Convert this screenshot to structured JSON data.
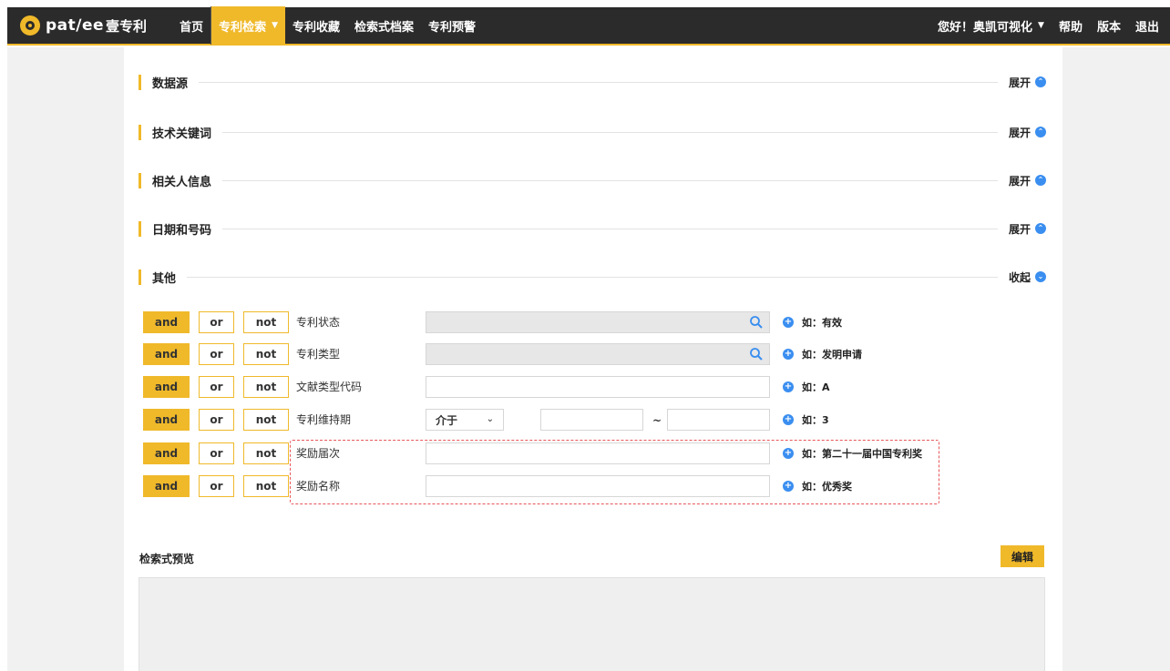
{
  "nav": {
    "logo_text": "pat∕ee",
    "logo_cn": "壹专利",
    "items": [
      {
        "label": "首页"
      },
      {
        "label": "专利检索",
        "active": true
      },
      {
        "label": "专利收藏"
      },
      {
        "label": "检索式档案"
      },
      {
        "label": "专利预警"
      }
    ],
    "greeting": "您好！奥凯可视化",
    "help": "帮助",
    "version": "版本",
    "logout": "退出"
  },
  "sections": [
    {
      "title": "数据源",
      "toggle": "展开",
      "state": "collapsed"
    },
    {
      "title": "技术关键词",
      "toggle": "展开",
      "state": "collapsed"
    },
    {
      "title": "相关人信息",
      "toggle": "展开",
      "state": "collapsed"
    },
    {
      "title": "日期和号码",
      "toggle": "展开",
      "state": "collapsed"
    },
    {
      "title": "其他",
      "toggle": "收起",
      "state": "expanded"
    }
  ],
  "operators": {
    "and": "and",
    "or": "or",
    "not": "not"
  },
  "fields": [
    {
      "label": "专利状态",
      "value": "",
      "hint": "如：有效",
      "type": "lookup"
    },
    {
      "label": "专利类型",
      "value": "",
      "hint": "如：发明申请",
      "type": "lookup"
    },
    {
      "label": "文献类型代码",
      "value": "",
      "hint": "如：A",
      "type": "text"
    },
    {
      "label": "专利维持期",
      "range_mode": "介于",
      "range_sep": "~",
      "from": "",
      "to": "",
      "hint": "如：3",
      "type": "range"
    },
    {
      "label": "奖励届次",
      "value": "",
      "hint": "如：第二十一届中国专利奖",
      "type": "text"
    },
    {
      "label": "奖励名称",
      "value": "",
      "hint": "如：优秀奖",
      "type": "text"
    }
  ],
  "preview": {
    "title": "检索式预览",
    "edit_label": "编辑",
    "content": ""
  },
  "colors": {
    "accent": "#f0b92a",
    "nav_bg": "#2b2b2b",
    "info_blue": "#3a8ef0",
    "highlight_dash": "#e8555a"
  }
}
